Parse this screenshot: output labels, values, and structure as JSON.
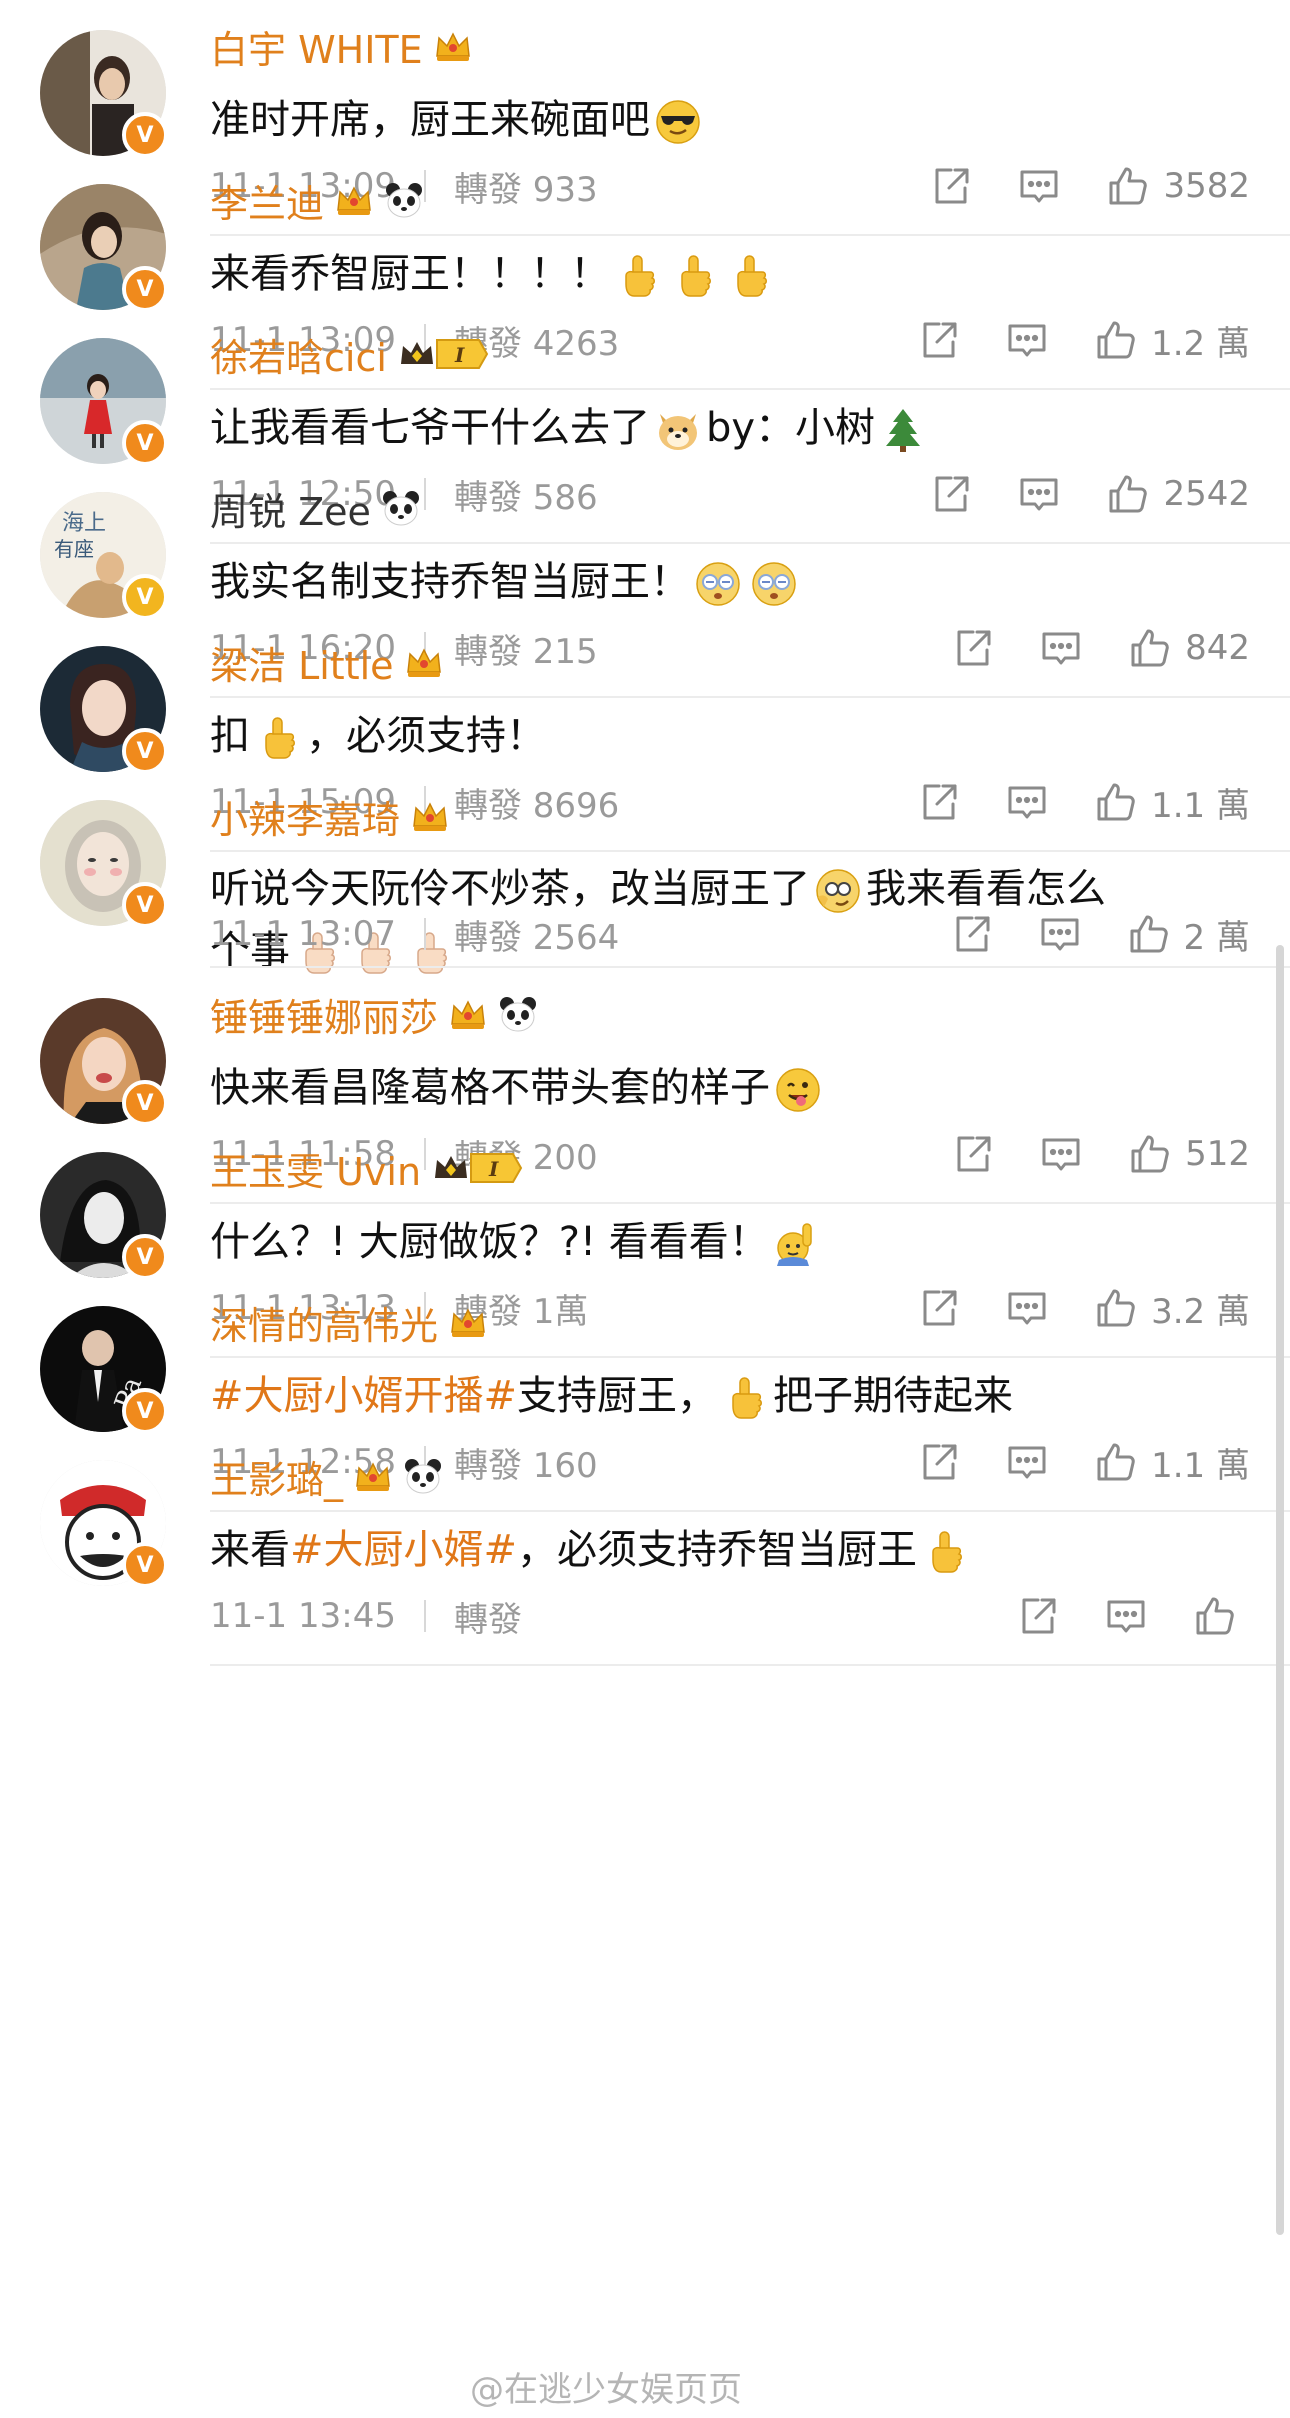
{
  "posts": [
    {
      "name": "白宇 WHITE",
      "content": [
        "准时开席，厨王来碗面吧"
      ],
      "time": "11-1 13:09",
      "repost": "轉發 933",
      "likes": "3582"
    },
    {
      "name": "李兰迪",
      "content": [
        "来看乔智厨王！！！！"
      ],
      "time": "11-1 13:09",
      "repost": "轉發 4263",
      "likes": "1.2 萬"
    },
    {
      "name": "徐若晗cici",
      "content": [
        "让我看看七爷干什么去了",
        "by：小树"
      ],
      "time": "11-1 12:50",
      "repost": "轉發 586",
      "likes": "2542"
    },
    {
      "name": "周锐 Zee",
      "content": [
        "我实名制支持乔智当厨王！"
      ],
      "time": "11-1 16:20",
      "repost": "轉發 215",
      "likes": "842"
    },
    {
      "name": "梁洁 Little",
      "content": [
        "扣",
        "，必须支持！"
      ],
      "time": "11-1 15:09",
      "repost": "轉發 8696",
      "likes": "1.1 萬"
    },
    {
      "name": "小辣李嘉琦",
      "content": [
        "听说今天阮伶不炒茶，改当厨王了",
        "我来看看怎么",
        "个事"
      ],
      "time": "11-1 13:07",
      "repost": "轉發 2564",
      "likes": "2 萬"
    },
    {
      "name": "锤锤锤娜丽莎",
      "content": [
        "快来看昌隆葛格不带头套的样子"
      ],
      "time": "11-1 11:58",
      "repost": "轉發 200",
      "likes": "512"
    },
    {
      "name": "王玉雯 Uvin",
      "content": [
        "什么？! 大厨做饭？?! 看看看！"
      ],
      "time": "11-1 13:13",
      "repost": "轉發 1萬",
      "likes": "3.2 萬"
    },
    {
      "name": "深情的高伟光",
      "content": [
        "#大厨小婿开播#",
        "支持厨王，",
        "把子期待起来"
      ],
      "time": "11-1 12:58",
      "repost": "轉發 160",
      "likes": "1.1 萬"
    },
    {
      "name": "王影璐_",
      "content": [
        "来看",
        "#大厨小婿#",
        "，必须支持乔智当厨王"
      ],
      "time": "11-1 13:45",
      "repost": "轉發",
      "likes": ""
    }
  ],
  "watermark": "@在逃少女娱页页",
  "icons": {
    "share": "share-icon",
    "comment": "comment-icon",
    "like": "thumbs-up-icon",
    "verified": "verified-badge-icon",
    "crown": "crown-icon",
    "panda": "panda-icon"
  },
  "colors": {
    "name": "#e0801c",
    "meta": "#9a9a9a",
    "badge": "#f08a1c",
    "hashtag": "#e07718"
  }
}
